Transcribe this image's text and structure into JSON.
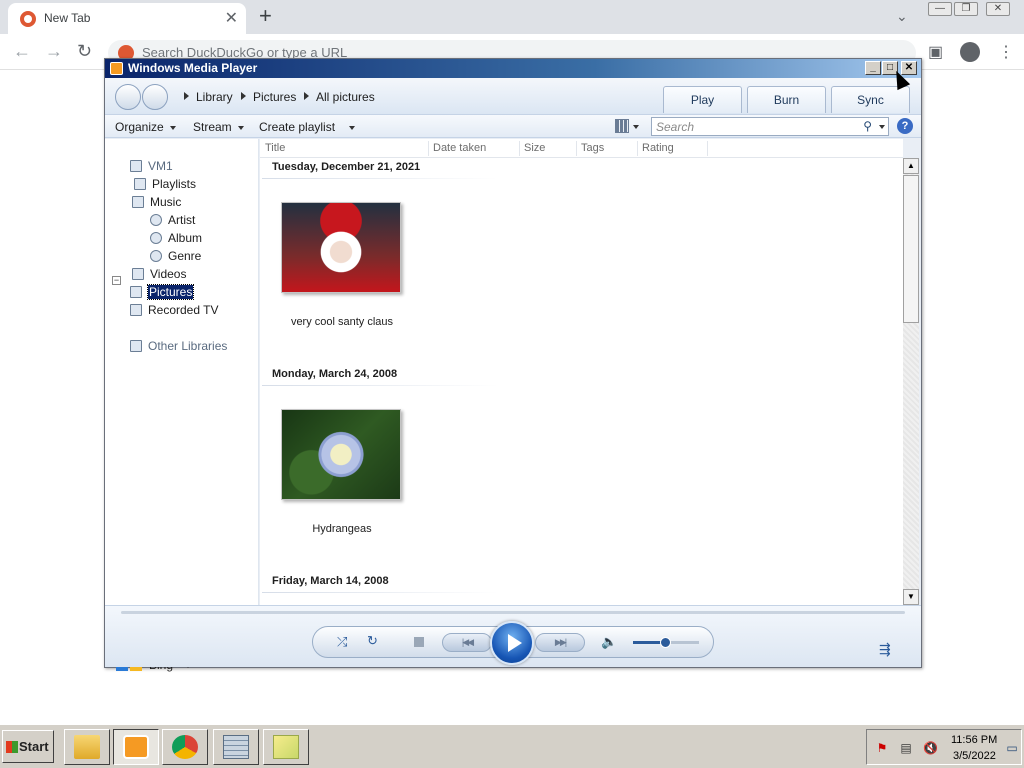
{
  "browser": {
    "tab_title": "New Tab",
    "new_tab_symbol": "+",
    "address_placeholder": "Search DuckDuckGo or type a URL"
  },
  "wmp": {
    "window_title": "Windows Media Player",
    "breadcrumb": [
      "Library",
      "Pictures",
      "All pictures"
    ],
    "tabs": [
      "Play",
      "Burn",
      "Sync"
    ],
    "commands": {
      "organize": "Organize",
      "stream": "Stream",
      "create_playlist": "Create playlist"
    },
    "search_placeholder": "Search",
    "help_symbol": "?",
    "nav": {
      "vm": "VM1",
      "playlists": "Playlists",
      "music": "Music",
      "artist": "Artist",
      "album": "Album",
      "genre": "Genre",
      "videos": "Videos",
      "pictures": "Pictures",
      "recorded_tv": "Recorded TV",
      "other_libraries": "Other Libraries",
      "bing": "Bing",
      "expand_symbol": "−"
    },
    "columns": [
      "Title",
      "Date taken",
      "Size",
      "Tags",
      "Rating"
    ],
    "groups": [
      {
        "date": "Tuesday, December 21, 2021",
        "caption": "very cool santy claus"
      },
      {
        "date": "Monday, March 24, 2008",
        "caption": "Hydrangeas"
      },
      {
        "date": "Friday, March 14, 2008"
      }
    ],
    "player": {
      "volume": 0.5
    }
  },
  "taskbar": {
    "start_label": "Start",
    "time": "11:56 PM",
    "date": "3/5/2022"
  },
  "colors": {
    "wmp_title_start": "#0a246a",
    "wmp_title_end": "#a6caf0",
    "selection": "#0a246a",
    "play_button": "#1655b4",
    "taskbar": "#d4d0c8"
  }
}
